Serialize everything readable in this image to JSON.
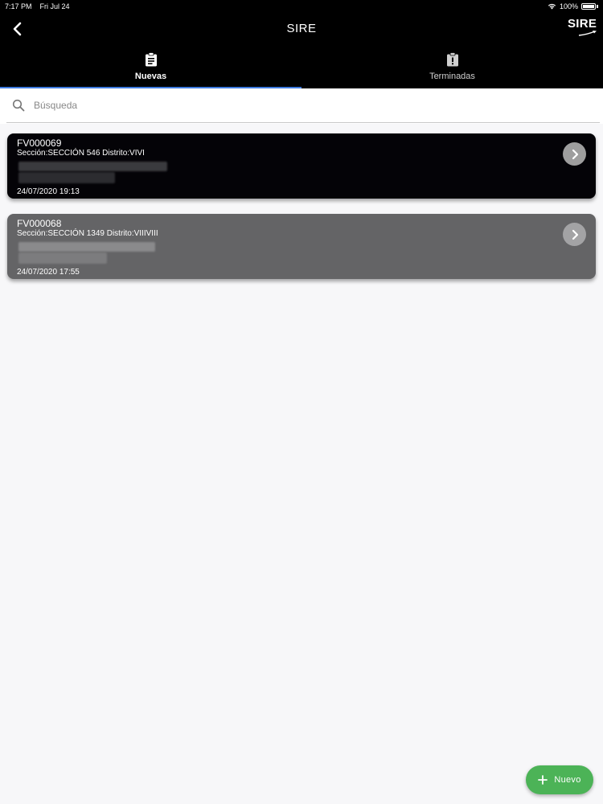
{
  "status_bar": {
    "time": "7:17 PM",
    "date": "Fri Jul 24",
    "battery": "100%"
  },
  "header": {
    "title": "SIRE",
    "logo_text": "SIRE"
  },
  "tabs": [
    {
      "label": "Nuevas",
      "icon": "clipboard-list-icon",
      "active": true
    },
    {
      "label": "Terminadas",
      "icon": "clipboard-alert-icon",
      "active": false
    }
  ],
  "search": {
    "placeholder": "Búsqueda",
    "value": ""
  },
  "cards": [
    {
      "code": "FV000069",
      "section": "Sección:SECCIÓN 546 Distrito:VIVI",
      "date": "24/07/2020 19:13"
    },
    {
      "code": "FV000068",
      "section": "Sección:SECCIÓN 1349 Distrito:VIIIVIII",
      "date": "24/07/2020 17:55"
    }
  ],
  "fab": {
    "label": "Nuevo",
    "icon": "plus-icon"
  },
  "colors": {
    "header_bg": "#000000",
    "tab_indicator": "#3e7be0",
    "card_active_bg": "#040307",
    "card_bg": "#646466",
    "fab_bg": "#4cb357",
    "page_bg": "#f7f7f9"
  }
}
